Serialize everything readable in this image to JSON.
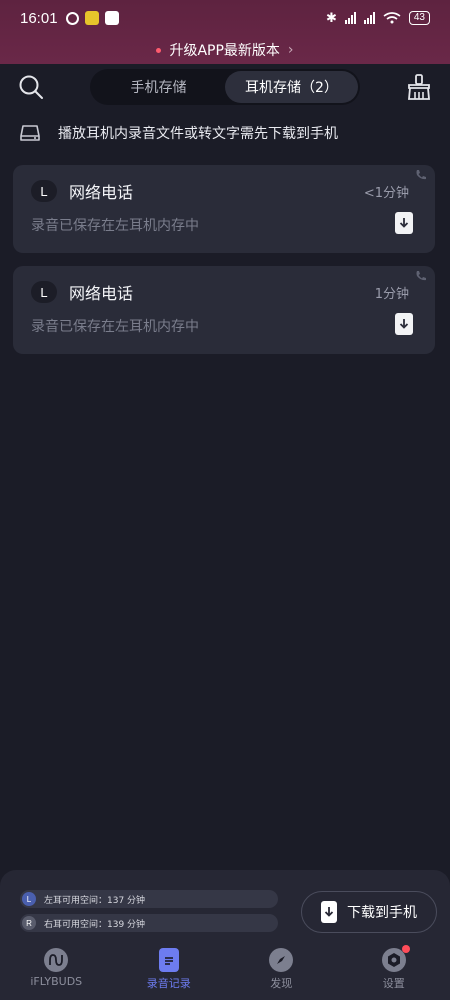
{
  "status_bar": {
    "time": "16:01",
    "battery": "43"
  },
  "banner": {
    "text": "升级APP最新版本",
    "chevron": "›"
  },
  "header": {
    "tabs": [
      {
        "label": "手机存储",
        "active": false
      },
      {
        "label": "耳机存储（2）",
        "active": true
      }
    ],
    "search_icon": "search-icon",
    "clean_icon": "broom-icon"
  },
  "info": {
    "text": "播放耳机内录音文件或转文字需先下载到手机",
    "icon": "drive-icon"
  },
  "recordings": [
    {
      "ear": "L",
      "title": "网络电话",
      "duration": "<1分钟",
      "status": "录音已保存在左耳机内存中"
    },
    {
      "ear": "L",
      "title": "网络电话",
      "duration": "1分钟",
      "status": "录音已保存在左耳机内存中"
    }
  ],
  "storage": {
    "left": {
      "ear": "L",
      "text": "左耳可用空间：137 分钟"
    },
    "right": {
      "ear": "R",
      "text": "右耳可用空间：139 分钟"
    }
  },
  "download_button": {
    "label": "下载到手机"
  },
  "nav": [
    {
      "label": "iFLYBUDS",
      "icon": "iflybuds-icon",
      "active": false
    },
    {
      "label": "录音记录",
      "icon": "document-icon",
      "active": true
    },
    {
      "label": "发现",
      "icon": "compass-icon",
      "active": false
    },
    {
      "label": "设置",
      "icon": "settings-icon",
      "active": false
    }
  ],
  "colors": {
    "accent": "#6d7cf0",
    "background": "#1b1c27",
    "card": "#2a2c39",
    "banner": "#5e2340"
  }
}
